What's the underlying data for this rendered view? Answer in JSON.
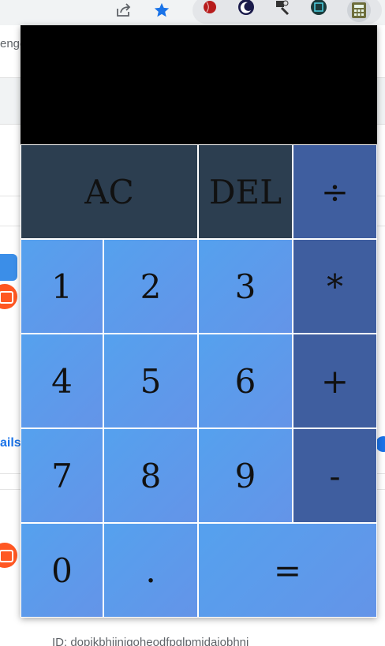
{
  "toolbar": {
    "share_icon": "share-icon",
    "bookmark_icon": "star-icon",
    "bookmark_color": "#1a73e8",
    "extensions": [
      {
        "name": "cricket-ball-extension-icon",
        "color": "#b71c1c"
      },
      {
        "name": "moon-extension-icon",
        "color": "#1a1a4a"
      },
      {
        "name": "paint-extension-icon",
        "color": "#333333"
      },
      {
        "name": "binary-extension-icon",
        "color": "#1b3a3a"
      },
      {
        "name": "calculator-extension-icon",
        "color": "#6d6d3b"
      }
    ]
  },
  "background_page": {
    "tab_fragment": "enge",
    "link_fragment": "ails",
    "extension_id": "ID: dopikbhijnigoheodfpglpmidajobhnj"
  },
  "calculator": {
    "display": "",
    "keys": {
      "clear": "AC",
      "delete": "DEL",
      "divide": "÷",
      "multiply": "*",
      "add": "+",
      "subtract": "-",
      "equals": "=",
      "decimal": ".",
      "one": "1",
      "two": "2",
      "three": "3",
      "four": "4",
      "five": "5",
      "six": "6",
      "seven": "7",
      "eight": "8",
      "nine": "9",
      "zero": "0"
    }
  },
  "colors": {
    "display_bg": "#000000",
    "dark_key": "#2c3e50",
    "operator_key": "#3f5e9f",
    "number_key_start": "#55a1ee",
    "number_key_end": "#6494e8"
  }
}
